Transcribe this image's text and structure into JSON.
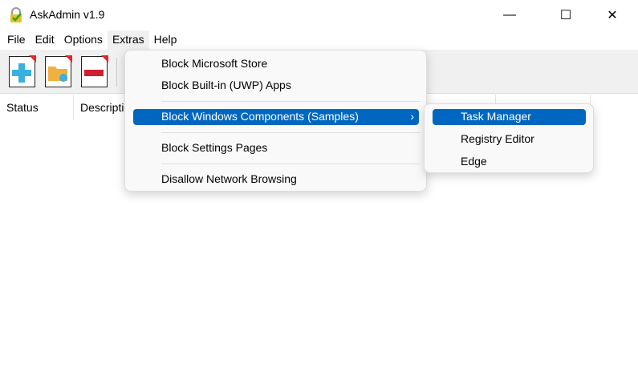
{
  "window": {
    "title": "AskAdmin v1.9",
    "minimize": "—",
    "maximize": "☐",
    "close": "✕"
  },
  "menubar": [
    "File",
    "Edit",
    "Options",
    "Extras",
    "Help"
  ],
  "toolbar": [
    {
      "icon": "add-icon"
    },
    {
      "icon": "add-folder-icon"
    },
    {
      "icon": "remove-icon"
    }
  ],
  "columns": [
    "Status",
    "Description"
  ],
  "extras_menu": {
    "items": [
      "Block Microsoft Store",
      "Block Built-in (UWP) Apps",
      "Block Windows Components (Samples)",
      "Block Settings Pages",
      "Disallow Network Browsing"
    ],
    "submenu_arrow": "›"
  },
  "submenu": [
    "Task Manager",
    "Registry Editor",
    "Edge"
  ],
  "colors": {
    "highlight": "#0067c0"
  }
}
